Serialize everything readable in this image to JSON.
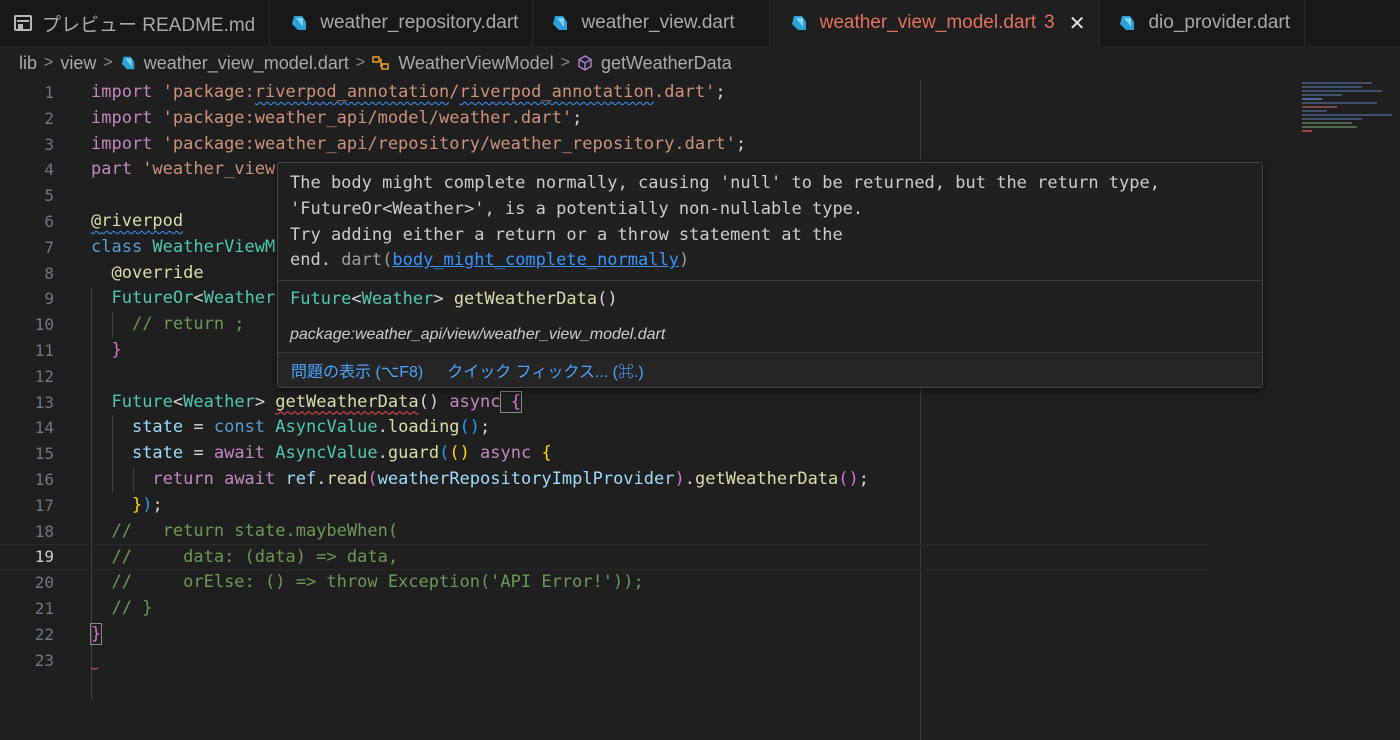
{
  "tabs": [
    {
      "label": "プレビュー README.md",
      "icon": "preview-icon"
    },
    {
      "label": "weather_repository.dart",
      "icon": "dart-icon"
    },
    {
      "label": "weather_view.dart",
      "icon": "dart-icon"
    },
    {
      "label": "weather_view_model.dart",
      "icon": "dart-icon",
      "badge": "3",
      "active": true
    },
    {
      "label": "dio_provider.dart",
      "icon": "dart-icon"
    }
  ],
  "breadcrumb": {
    "lib": "lib",
    "view": "view",
    "file": "weather_view_model.dart",
    "cls": "WeatherViewModel",
    "method": "getWeatherData"
  },
  "line_numbers": [
    "1",
    "2",
    "3",
    "4",
    "5",
    "6",
    "7",
    "8",
    "9",
    "10",
    "11",
    "12",
    "13",
    "14",
    "15",
    "16",
    "17",
    "18",
    "19",
    "20",
    "21",
    "22",
    "23"
  ],
  "current_line": "19",
  "code": {
    "l1": {
      "a": "import ",
      "b": "'package:",
      "c": "riverpod_annotation",
      "d": "/",
      "e": "riverpod_annotation",
      "f": ".dart'",
      "g": ";"
    },
    "l2": {
      "a": "import ",
      "b": "'package:weather_api/model/weather.dart'",
      "c": ";"
    },
    "l3": {
      "a": "import ",
      "b": "'package:weather_api/repository/weather_repository.dart'",
      "c": ";"
    },
    "l4": {
      "a": "part ",
      "b": "'weather_view"
    },
    "l6": {
      "a": "@",
      "b": "riverpod"
    },
    "l7": {
      "a": "class ",
      "b": "WeatherViewM"
    },
    "l8": {
      "a": "@override"
    },
    "l9": {
      "a": "FutureOr",
      "b": "<",
      "c": "Weather"
    },
    "l10": {
      "a": "// return ;"
    },
    "l11": {
      "a": "}"
    },
    "l13": {
      "a": "Future",
      "b": "<",
      "c": "Weather",
      "d": "> ",
      "e": "getWeatherData",
      "f": "() ",
      "g": "async",
      "h": " {"
    },
    "l14": {
      "a": "state",
      "b": " = ",
      "c": "const ",
      "d": "AsyncValue",
      "e": ".",
      "f": "loading",
      "g": "()",
      "h": ";"
    },
    "l15": {
      "a": "state",
      "b": " = ",
      "c": "await ",
      "d": "AsyncValue",
      "e": ".",
      "f": "guard",
      "g": "(",
      "h": "()",
      "i": " async ",
      "j": "{"
    },
    "l16": {
      "a": "return ",
      "b": "await ",
      "c": "ref",
      "d": ".",
      "e": "read",
      "f": "(",
      "g": "weatherRepositoryImplProvider",
      "h": ")",
      "i": ".",
      "j": "getWeatherData",
      "k": "()",
      "l": ";"
    },
    "l17": {
      "a": "}",
      "b": ")",
      "c": ";"
    },
    "l18": {
      "a": "//   return state.maybeWhen("
    },
    "l19": {
      "a": "//     data: (data) => data,"
    },
    "l20": {
      "a": "//     orElse: () => throw Exception('API Error!'));"
    },
    "l21": {
      "a": "// }"
    },
    "l22": {
      "a": "}"
    }
  },
  "hover": {
    "message_lines": [
      "The body might complete normally, causing 'null' to be returned, but the return type,",
      "'FutureOr<Weather>', is a potentially non-nullable type.",
      "Try adding either a return or a throw statement at the"
    ],
    "message_last": "end. ",
    "source": "dart(",
    "code_link": "body_might_complete_normally",
    "source_close": ")",
    "signature": {
      "type": "Future",
      "lt": "<",
      "arg": "Weather",
      "gt": "> ",
      "name": "getWeatherData",
      "parens": "()"
    },
    "path": "package:weather_api/view/weather_view_model.dart",
    "actions": [
      "問題の表示 (⌥F8)",
      "クイック フィックス... (⌘.)"
    ]
  },
  "colors": {
    "accent_error": "#e2715e",
    "link": "#3794ff"
  }
}
